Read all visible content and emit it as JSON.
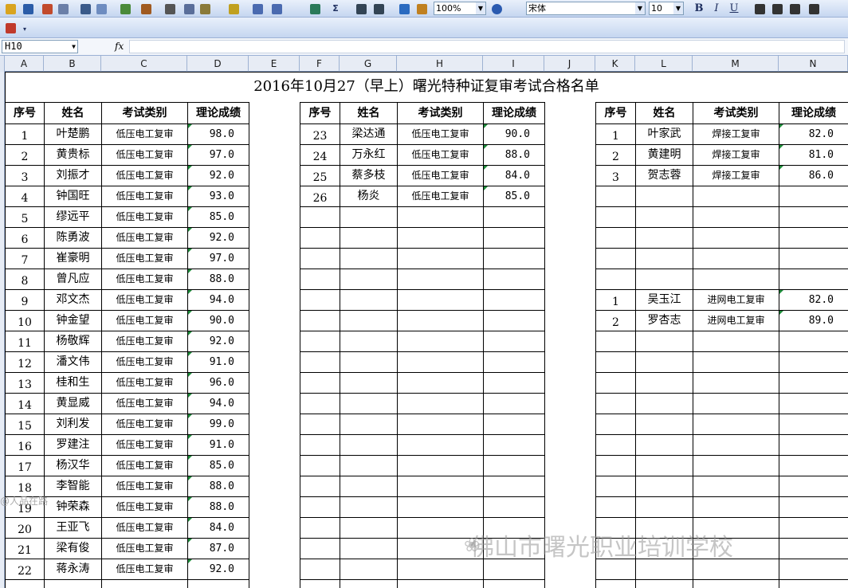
{
  "toolbar": {
    "zoom": "100%",
    "font_name": "宋体",
    "font_size": "10",
    "bold": "B",
    "italic": "I",
    "underline": "U",
    "sum_symbol": "Σ",
    "icons": [
      "open-icon",
      "save-icon",
      "permission-icon",
      "print-preview-icon",
      "print-icon",
      "preview-icon",
      "spelling-icon",
      "research-icon",
      "cut-icon",
      "copy-icon",
      "paste-icon",
      "format-painter-icon",
      "undo-icon",
      "redo-icon",
      "hyperlink-icon",
      "autosum-icon",
      "sort-ascending-icon",
      "sort-descending-icon",
      "chart-wizard-icon",
      "drawing-icon",
      "help-icon",
      "align-left-icon",
      "align-center-icon",
      "align-right-icon",
      "merge-center-icon"
    ]
  },
  "formula_bar": {
    "name_box": "H10",
    "fx_label": "fx",
    "formula": ""
  },
  "columns": [
    "A",
    "B",
    "C",
    "D",
    "E",
    "F",
    "G",
    "H",
    "I",
    "J",
    "K",
    "L",
    "M",
    "N"
  ],
  "sheet": {
    "title": "2016年10月27（早上）曙光特种证复审考试合格名单",
    "headers": [
      "序号",
      "姓名",
      "考试类别",
      "理论成绩"
    ],
    "left_table": [
      {
        "seq": "1",
        "name": "叶楚鹏",
        "type": "低压电工复审",
        "score": "98.0"
      },
      {
        "seq": "2",
        "name": "黄贵标",
        "type": "低压电工复审",
        "score": "97.0"
      },
      {
        "seq": "3",
        "name": "刘振才",
        "type": "低压电工复审",
        "score": "92.0"
      },
      {
        "seq": "4",
        "name": "钟国旺",
        "type": "低压电工复审",
        "score": "93.0"
      },
      {
        "seq": "5",
        "name": "缪远平",
        "type": "低压电工复审",
        "score": "85.0"
      },
      {
        "seq": "6",
        "name": "陈勇波",
        "type": "低压电工复审",
        "score": "92.0"
      },
      {
        "seq": "7",
        "name": "崔豪明",
        "type": "低压电工复审",
        "score": "97.0"
      },
      {
        "seq": "8",
        "name": "曾凡应",
        "type": "低压电工复审",
        "score": "88.0"
      },
      {
        "seq": "9",
        "name": "邓文杰",
        "type": "低压电工复审",
        "score": "94.0"
      },
      {
        "seq": "10",
        "name": "钟金望",
        "type": "低压电工复审",
        "score": "90.0"
      },
      {
        "seq": "11",
        "name": "杨敬辉",
        "type": "低压电工复审",
        "score": "92.0"
      },
      {
        "seq": "12",
        "name": "潘文伟",
        "type": "低压电工复审",
        "score": "91.0"
      },
      {
        "seq": "13",
        "name": "桂和生",
        "type": "低压电工复审",
        "score": "96.0"
      },
      {
        "seq": "14",
        "name": "黄显威",
        "type": "低压电工复审",
        "score": "94.0"
      },
      {
        "seq": "15",
        "name": "刘利发",
        "type": "低压电工复审",
        "score": "99.0"
      },
      {
        "seq": "16",
        "name": "罗建注",
        "type": "低压电工复审",
        "score": "91.0"
      },
      {
        "seq": "17",
        "name": "杨汉华",
        "type": "低压电工复审",
        "score": "85.0"
      },
      {
        "seq": "18",
        "name": "李智能",
        "type": "低压电工复审",
        "score": "88.0"
      },
      {
        "seq": "19",
        "name": "钟荣森",
        "type": "低压电工复审",
        "score": "88.0"
      },
      {
        "seq": "20",
        "name": "王亚飞",
        "type": "低压电工复审",
        "score": "84.0"
      },
      {
        "seq": "21",
        "name": "梁有俊",
        "type": "低压电工复审",
        "score": "87.0"
      },
      {
        "seq": "22",
        "name": "蒋永涛",
        "type": "低压电工复审",
        "score": "92.0"
      }
    ],
    "middle_table": [
      {
        "seq": "23",
        "name": "梁达通",
        "type": "低压电工复审",
        "score": "90.0"
      },
      {
        "seq": "24",
        "name": "万永红",
        "type": "低压电工复审",
        "score": "88.0"
      },
      {
        "seq": "25",
        "name": "蔡多枝",
        "type": "低压电工复审",
        "score": "84.0"
      },
      {
        "seq": "26",
        "name": "杨炎",
        "type": "低压电工复审",
        "score": "85.0"
      }
    ],
    "right_table": [
      {
        "row": 0,
        "seq": "1",
        "name": "叶家武",
        "type": "焊接工复审",
        "score": "82.0"
      },
      {
        "row": 1,
        "seq": "2",
        "name": "黄建明",
        "type": "焊接工复审",
        "score": "81.0"
      },
      {
        "row": 2,
        "seq": "3",
        "name": "贺志蓉",
        "type": "焊接工复审",
        "score": "86.0"
      },
      {
        "row": 8,
        "seq": "1",
        "name": "吴玉江",
        "type": "进网电工复审",
        "score": "82.0"
      },
      {
        "row": 9,
        "seq": "2",
        "name": "罗杏志",
        "type": "进网电工复审",
        "score": "89.0"
      }
    ]
  },
  "watermark": {
    "text": "佛山市曙光职业培训学校",
    "secondary": "@人品在路"
  }
}
